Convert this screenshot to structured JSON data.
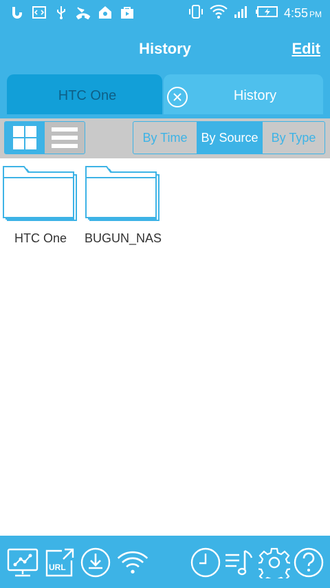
{
  "status_bar": {
    "time": "4:55",
    "ampm": "PM",
    "left_icons": [
      "b-app-icon",
      "code-icon",
      "usb-icon",
      "missed-call-icon",
      "home-lock-icon",
      "store-icon"
    ],
    "right_icons": [
      "vibrate-icon",
      "wifi-icon",
      "signal-icon",
      "battery-charging-icon"
    ]
  },
  "header": {
    "title": "History",
    "edit_label": "Edit"
  },
  "tabs": [
    {
      "label": "HTC One"
    },
    {
      "label": "History"
    }
  ],
  "toolbar": {
    "sort_options": [
      "By Time",
      "By Source",
      "By Type"
    ],
    "selected_sort": "By Source",
    "view_mode": "grid"
  },
  "folders": [
    {
      "name": "HTC One"
    },
    {
      "name": "BUGUN_NAS"
    }
  ],
  "bottom_nav": [
    "network-devices-icon",
    "url-icon",
    "download-icon",
    "wifi-icon",
    "history-clock-icon",
    "playlist-icon",
    "settings-gear-icon",
    "help-icon"
  ],
  "colors": {
    "primary": "#3db3e6",
    "tab_dark": "#129fd8",
    "toolbar_bg": "#c9c9c9"
  }
}
